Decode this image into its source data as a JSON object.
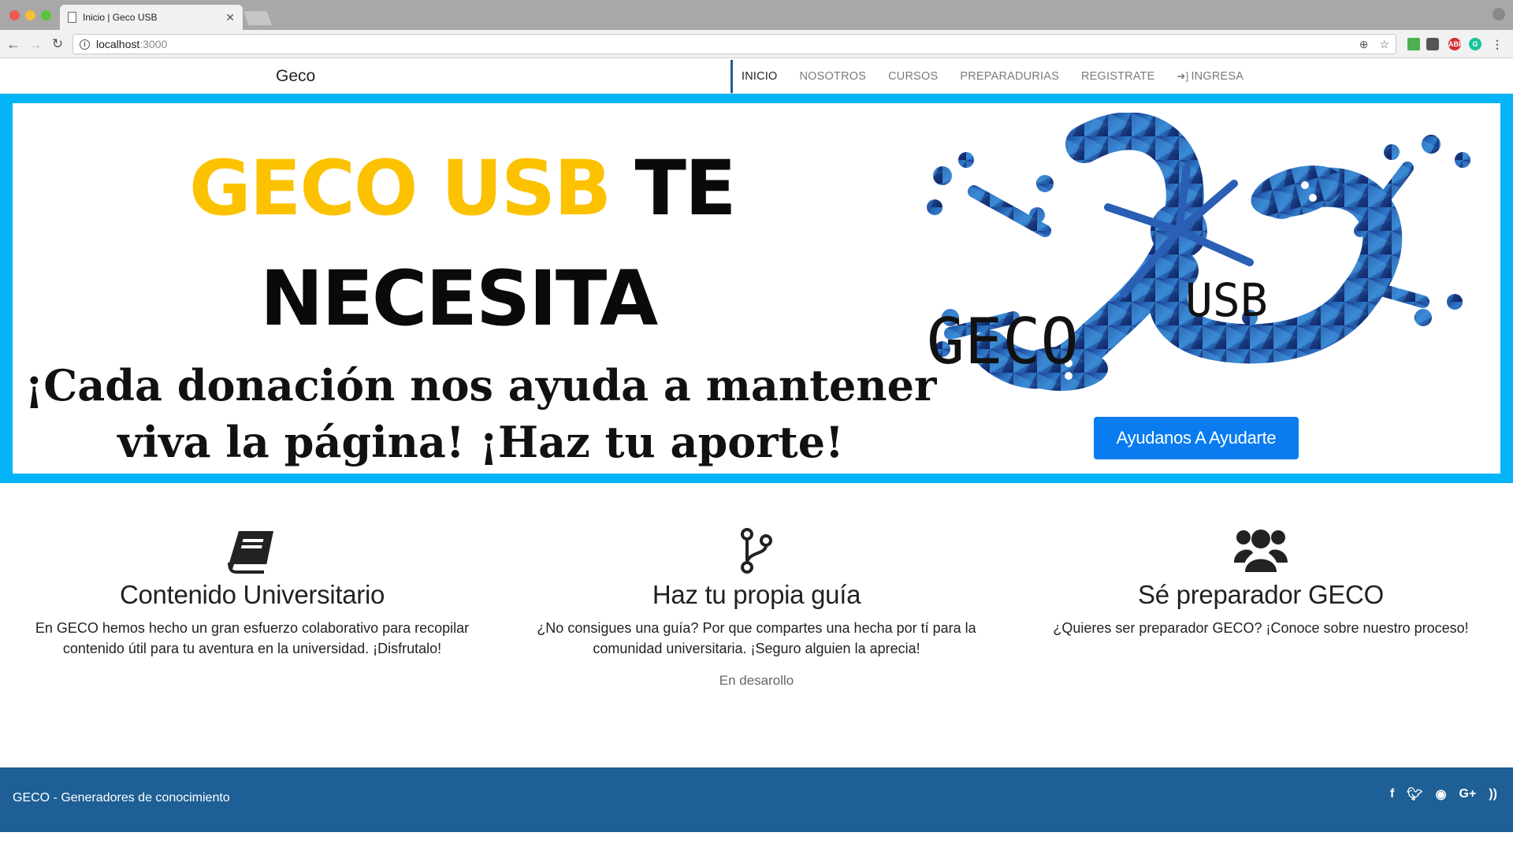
{
  "browser": {
    "tab_title": "Inicio | Geco USB",
    "url_host": "localhost",
    "url_port": ":3000",
    "ext_abp": "ABP"
  },
  "nav": {
    "brand": "Geco",
    "links": [
      "INICIO",
      "NOSOTROS",
      "CURSOS",
      "PREPARADURIAS",
      "REGISTRATE",
      "INGRESA"
    ],
    "active": "INICIO"
  },
  "hero": {
    "line1_yellow": "GECO USB",
    "line1_black": "TE",
    "line2": "NECESITA",
    "line3": "¡Cada donación nos ayuda a mantener viva la página! ¡Haz tu aporte!",
    "logo_text_1": "GECO",
    "logo_text_2": "USB",
    "cta": "Ayudanos A Ayudarte"
  },
  "features": [
    {
      "icon": "book-icon",
      "title": "Contenido Universitario",
      "desc": "En GECO hemos hecho un gran esfuerzo colaborativo para recopilar contenido útil para tu aventura en la universidad. ¡Disfrutalo!"
    },
    {
      "icon": "code-fork-icon",
      "title": "Haz tu propia guía",
      "desc": "¿No consigues una guía? Por que compartes una hecha por tí para la comunidad universitaria. ¡Seguro alguien la aprecia!",
      "note": "En desarollo"
    },
    {
      "icon": "users-icon",
      "title": "Sé preparador GECO",
      "desc": "¿Quieres ser preparador GECO? ¡Conoce sobre nuestro proceso!"
    }
  ],
  "footer": {
    "text": "GECO - Generadores de conocimiento",
    "social": [
      "facebook-icon",
      "twitter-icon",
      "github-icon",
      "google-plus-icon",
      "rss-icon"
    ]
  },
  "colors": {
    "hero_border": "#04b4f8",
    "accent_yellow": "#fcc200",
    "cta_blue": "#0a7cf0",
    "footer_blue": "#1e5f95"
  }
}
